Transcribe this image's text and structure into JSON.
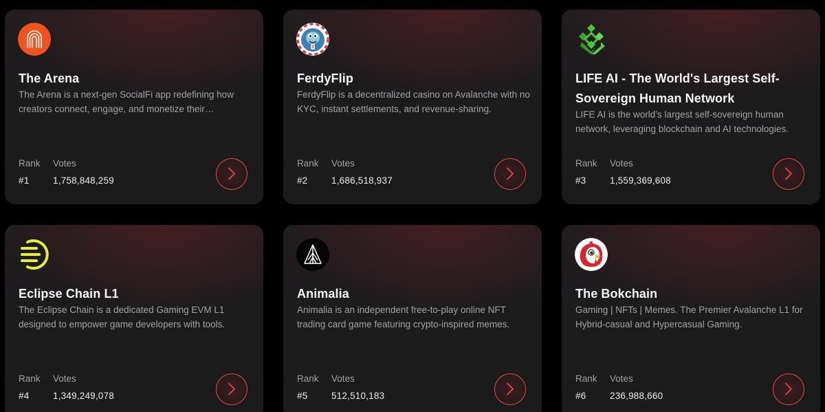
{
  "labels": {
    "rank": "Rank",
    "votes": "Votes"
  },
  "colors": {
    "background": "#000000",
    "card": "#1c1c1d",
    "accent": "#e0484c",
    "title": "#f4f4f4",
    "muted": "#a3a3a6"
  },
  "projects": [
    {
      "name": "The Arena",
      "description": "The Arena is a next-gen SocialFi app redefining how creators connect, engage, and monetize their communities.",
      "rank": "#1",
      "votes": "1,758,848,259",
      "icon": "arena-logo-icon"
    },
    {
      "name": "FerdyFlip",
      "description": "FerdyFlip is a decentralized casino on Avalanche with no KYC, instant settlements, and revenue-sharing.",
      "rank": "#2",
      "votes": "1,686,518,937",
      "icon": "ferdyflip-logo-icon"
    },
    {
      "name": "LIFE AI - The World's Largest Self-Sovereign Human Network",
      "description": "LIFE AI is the world’s largest self-sovereign human network, leveraging blockchain and AI technologies.",
      "rank": "#3",
      "votes": "1,559,369,608",
      "icon": "life-ai-logo-icon"
    },
    {
      "name": "Eclipse Chain L1",
      "description": "The Eclipse Chain is a dedicated Gaming EVM L1 designed to empower game developers with tools.",
      "rank": "#4",
      "votes": "1,349,249,078",
      "icon": "eclipse-chain-logo-icon"
    },
    {
      "name": "Animalia",
      "description": "Animalia is an independent free-to-play online NFT trading card game featuring crypto-inspired memes.",
      "rank": "#5",
      "votes": "512,510,183",
      "icon": "animalia-logo-icon"
    },
    {
      "name": "The Bokchain",
      "description": "Gaming | NFTs | Memes. The Premier Avalanche L1 for Hybrid-casual and Hypercasual Gaming.",
      "rank": "#6",
      "votes": "236,988,660",
      "icon": "bokchain-logo-icon"
    }
  ]
}
